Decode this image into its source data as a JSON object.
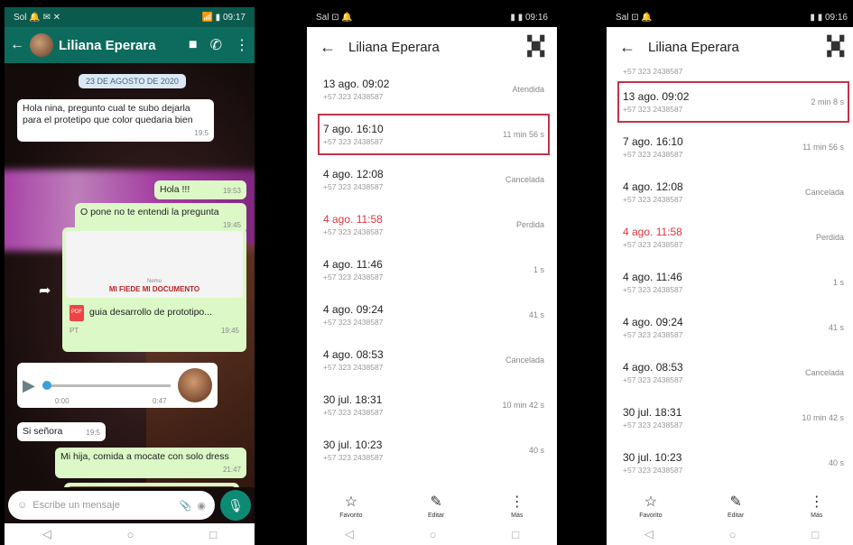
{
  "whatsapp": {
    "status": {
      "left": "Sol 🔔 ✉ ✕",
      "right": "📶 ▮ 09:17"
    },
    "contact_name": "Liliana Eperara",
    "date_chip": "23 DE AGOSTO DE 2020",
    "messages": {
      "m1": "Hola nina, pregunto cual te subo dejarla para el protetipo que color quedaria bien",
      "m1_time": "19:5",
      "m2": "Hola !!!",
      "m2_time": "19:53",
      "m3": "O pone no te entendi la pregunta",
      "m3_time": "19:45",
      "doc_small": "Nemu",
      "doc_title": "MI FIEDE   MI DOCUMENTO",
      "doc_name": "guia desarrollo de prototipo...",
      "doc_badge": "PDF",
      "doc_meta_left": "PT",
      "doc_meta_right": "19:45",
      "voice_start": "0:00",
      "voice_end": "0:47",
      "m6": "Si señora",
      "m6_time": "19:5",
      "m7": "Mi hija, comida a mocate con solo dress",
      "m7_time": "21:47"
    },
    "input_placeholder": "Escribe un mensaje"
  },
  "calls_left": {
    "status": {
      "left": "Sal ⊡ 🔔",
      "right": "▮ ▮ 09:16"
    },
    "contact_name": "Liliana Eperara",
    "partial_number": "",
    "rows": [
      {
        "when": "13 ago. 09:02",
        "number": "+57 323 2438587",
        "duration": "Atendida",
        "missed": false,
        "hl": false
      },
      {
        "when": "7 ago. 16:10",
        "number": "+57 323 2438587",
        "duration": "11 min 56 s",
        "missed": false,
        "hl": true
      },
      {
        "when": "4 ago. 12:08",
        "number": "+57 323 2438587",
        "duration": "Cancelada",
        "missed": false,
        "hl": false
      },
      {
        "when": "4 ago. 11:58",
        "number": "+57 323 2438587",
        "duration": "Perdida",
        "missed": true,
        "hl": false
      },
      {
        "when": "4 ago. 11:46",
        "number": "+57 323 2438587",
        "duration": "1 s",
        "missed": false,
        "hl": false
      },
      {
        "when": "4 ago. 09:24",
        "number": "+57 323 2438587",
        "duration": "41 s",
        "missed": false,
        "hl": false
      },
      {
        "when": "4 ago. 08:53",
        "number": "+57 323 2438587",
        "duration": "Cancelada",
        "missed": false,
        "hl": false
      },
      {
        "when": "30 jul. 18:31",
        "number": "+57 323 2438587",
        "duration": "10 min 42 s",
        "missed": false,
        "hl": false
      },
      {
        "when": "30 jul. 10:23",
        "number": "+57 323 2438587",
        "duration": "40 s",
        "missed": false,
        "hl": false
      }
    ],
    "actions": [
      "Favorito",
      "Editar",
      "Más"
    ]
  },
  "calls_right": {
    "status": {
      "left": "Sal ⊡ 🔔",
      "right": "▮ ▮ 09:16"
    },
    "contact_name": "Liliana Eperara",
    "partial_number": "+57 323 2438587",
    "rows": [
      {
        "when": "13 ago. 09:02",
        "number": "+57 323 2438587",
        "duration": "2 min 8 s",
        "missed": false,
        "hl": true
      },
      {
        "when": "7 ago. 16:10",
        "number": "+57 323 2438587",
        "duration": "11 min 56 s",
        "missed": false,
        "hl": false
      },
      {
        "when": "4 ago. 12:08",
        "number": "+57 323 2438587",
        "duration": "Cancelada",
        "missed": false,
        "hl": false
      },
      {
        "when": "4 ago. 11:58",
        "number": "+57 323 2438587",
        "duration": "Perdida",
        "missed": true,
        "hl": false
      },
      {
        "when": "4 ago. 11:46",
        "number": "+57 323 2438587",
        "duration": "1 s",
        "missed": false,
        "hl": false
      },
      {
        "when": "4 ago. 09:24",
        "number": "+57 323 2438587",
        "duration": "41 s",
        "missed": false,
        "hl": false
      },
      {
        "when": "4 ago. 08:53",
        "number": "+57 323 2438587",
        "duration": "Cancelada",
        "missed": false,
        "hl": false
      },
      {
        "when": "30 jul. 18:31",
        "number": "+57 323 2438587",
        "duration": "10 min 42 s",
        "missed": false,
        "hl": false
      },
      {
        "when": "30 jul. 10:23",
        "number": "+57 323 2438587",
        "duration": "40 s",
        "missed": false,
        "hl": false
      }
    ],
    "actions": [
      "Favorito",
      "Editar",
      "Más"
    ]
  },
  "icons": {
    "back": "←",
    "video": "■",
    "phone": "✆",
    "more": "⋮",
    "star": "☆",
    "pencil": "✎",
    "qr": "▪▪",
    "nav_back": "◁",
    "nav_home": "○",
    "nav_recent": "□"
  },
  "colors": {
    "wa_header": "#0d6b5d",
    "highlight": "#c2334a",
    "missed": "#e0343c"
  }
}
